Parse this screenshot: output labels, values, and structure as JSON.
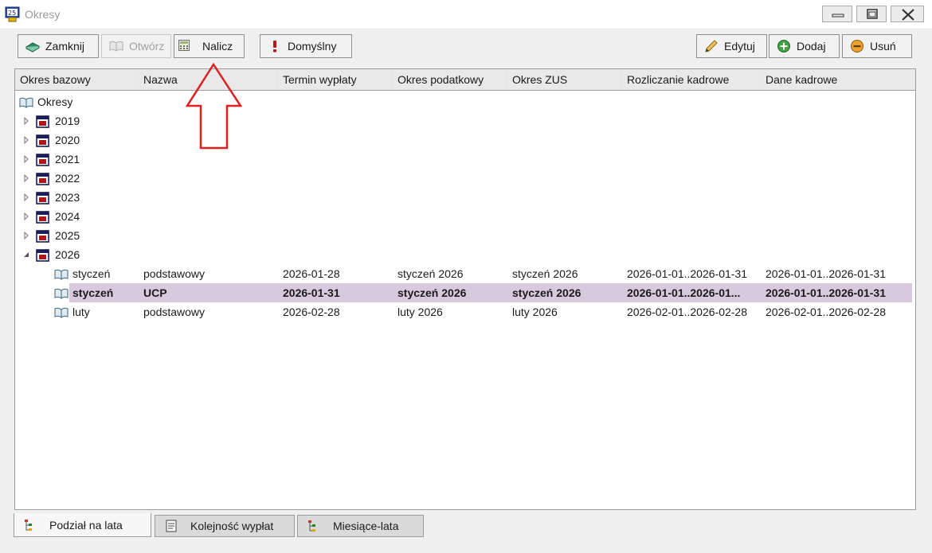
{
  "window": {
    "title": "Okresy"
  },
  "toolbar": {
    "close_label": "Zamknij",
    "open_label": "Otwórz",
    "calc_label": "Nalicz",
    "default_label": "Domyślny",
    "edit_label": "Edytuj",
    "add_label": "Dodaj",
    "remove_label": "Usuń"
  },
  "columns": [
    "Okres bazowy",
    "Nazwa",
    "Termin wypłaty",
    "Okres podatkowy",
    "Okres ZUS",
    "Rozliczanie kadrowe",
    "Dane kadrowe"
  ],
  "tree": {
    "root_label": "Okresy",
    "years": [
      "2019",
      "2020",
      "2021",
      "2022",
      "2023",
      "2024",
      "2025",
      "2026"
    ],
    "expanded_year": "2026"
  },
  "periods": [
    {
      "base": "styczeń",
      "name": "podstawowy",
      "payment_date": "2026-01-28",
      "tax_period": "styczeń 2026",
      "zus_period": "styczeń 2026",
      "hr_settlement": "2026-01-01..2026-01-31",
      "hr_data": "2026-01-01..2026-01-31"
    },
    {
      "base": "styczeń",
      "name": "UCP",
      "payment_date": "2026-01-31",
      "tax_period": "styczeń 2026",
      "zus_period": "styczeń 2026",
      "hr_settlement": "2026-01-01..2026-01...",
      "hr_data": "2026-01-01..2026-01-31"
    },
    {
      "base": "luty",
      "name": "podstawowy",
      "payment_date": "2026-02-28",
      "tax_period": "luty 2026",
      "zus_period": "luty 2026",
      "hr_settlement": "2026-02-01..2026-02-28",
      "hr_data": "2026-02-01..2026-02-28"
    }
  ],
  "selected_period_index": 1,
  "tabs": [
    "Podział na lata",
    "Kolejność wypłat",
    "Miesiące-lata"
  ],
  "active_tab_index": 0,
  "colors": {
    "selection": "#d9c9df",
    "annotation_arrow": "#e02020"
  }
}
